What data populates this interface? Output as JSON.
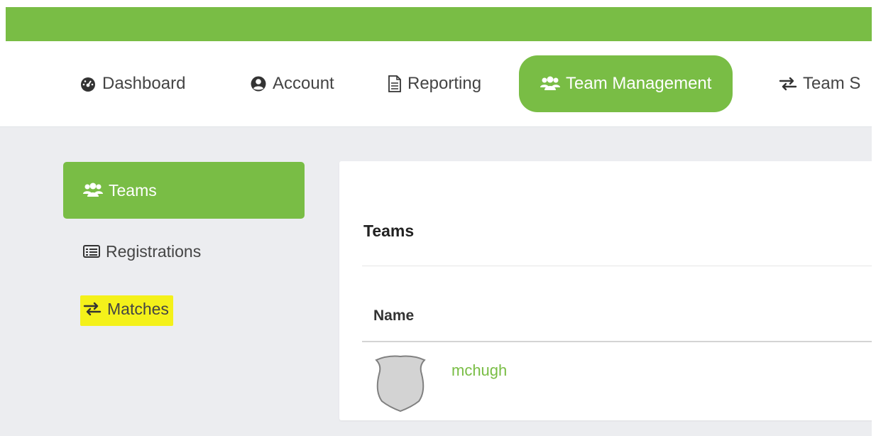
{
  "colors": {
    "accent": "#79bd45",
    "highlight": "#f4f11a"
  },
  "nav": {
    "items": [
      {
        "label": "Dashboard",
        "icon": "dashboard-icon"
      },
      {
        "label": "Account",
        "icon": "account-icon"
      },
      {
        "label": "Reporting",
        "icon": "report-icon"
      },
      {
        "label": "Team Management",
        "icon": "users-icon",
        "active": true
      },
      {
        "label": "Team S",
        "icon": "exchange-icon"
      }
    ]
  },
  "sidebar": {
    "items": [
      {
        "label": "Teams",
        "icon": "users-icon",
        "active": true
      },
      {
        "label": "Registrations",
        "icon": "list-icon"
      },
      {
        "label": "Matches",
        "icon": "exchange-icon",
        "highlighted": true
      }
    ]
  },
  "panel": {
    "title": "Teams",
    "columns": [
      "Name"
    ],
    "rows": [
      {
        "name": "mchugh",
        "icon": "team-crest-icon"
      }
    ]
  }
}
